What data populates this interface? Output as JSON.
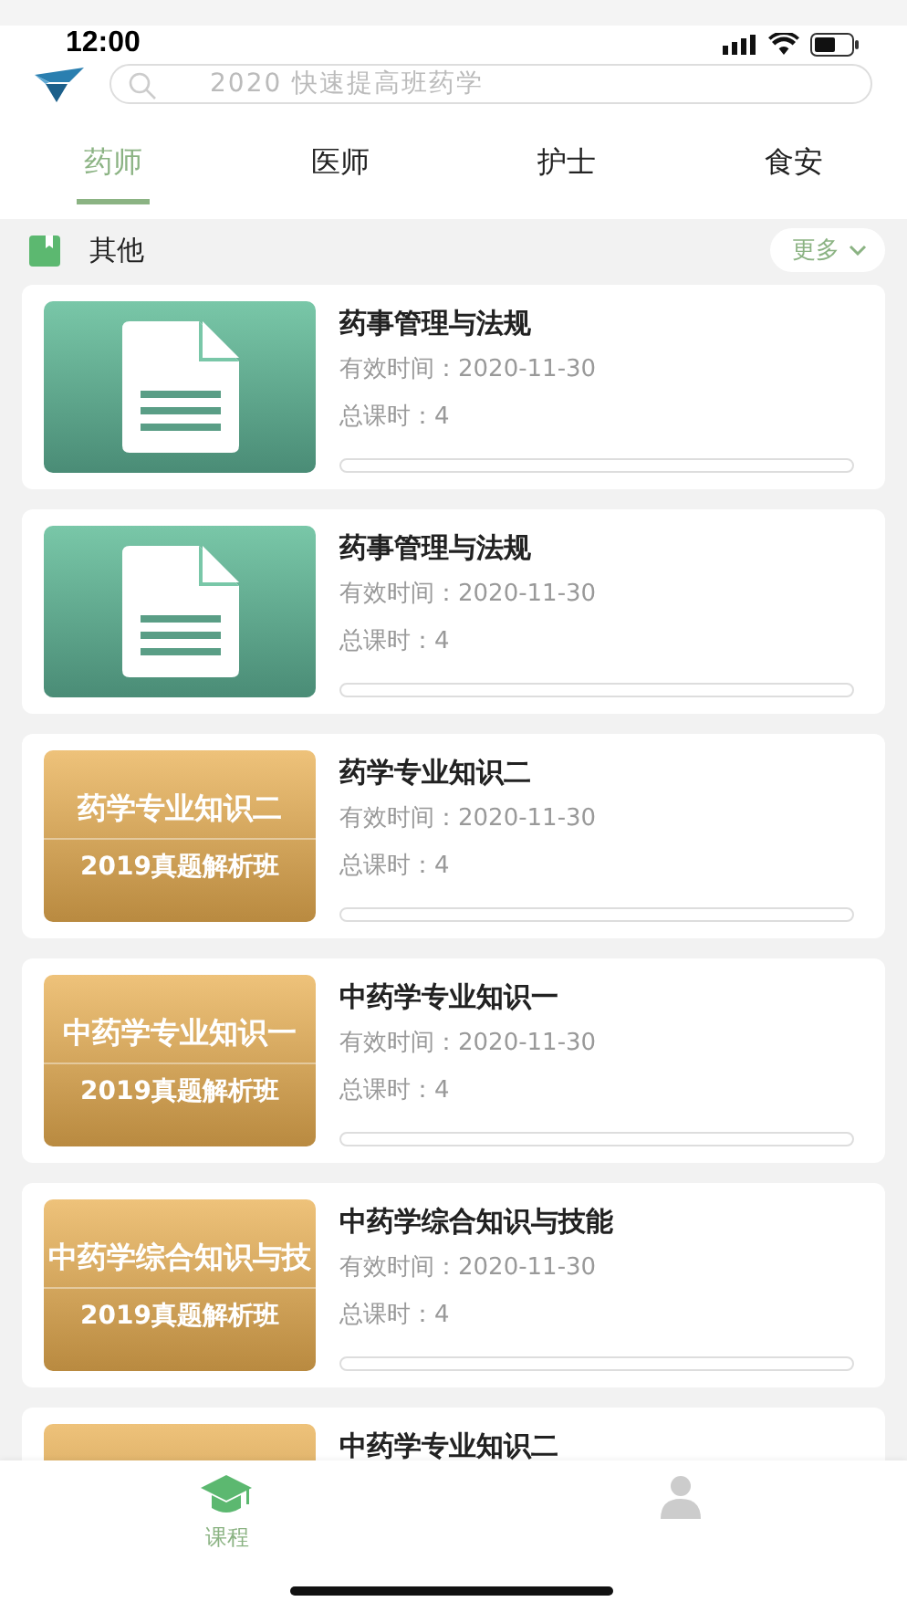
{
  "status_bar": {
    "time": "12:00"
  },
  "search": {
    "placeholder": "2020 快速提高班药学"
  },
  "tabs": [
    {
      "label": "药师",
      "selected": true
    },
    {
      "label": "医师",
      "selected": false
    },
    {
      "label": "护士",
      "selected": false
    },
    {
      "label": "食安",
      "selected": false
    }
  ],
  "section": {
    "title": "其他",
    "more": "更多"
  },
  "courses": [
    {
      "title": "药事管理与法规",
      "valid": "有效时间：2020-11-30",
      "hours": "总课时：4",
      "level": 0,
      "thumbnail": {
        "kind": "document"
      }
    },
    {
      "title": "药事管理与法规",
      "valid": "有效时间：2020-11-30",
      "hours": "总课时：4",
      "level": 0,
      "thumbnail": {
        "kind": "document"
      }
    },
    {
      "title": "药学专业知识二",
      "valid": "有效时间：2020-11-30",
      "hours": "总课时：4",
      "level": 0,
      "thumbnail": {
        "kind": "banner",
        "heading": "药学专业知识二",
        "subheading": "2019真题解析班"
      }
    },
    {
      "title": "中药学专业知识一",
      "valid": "有效时间：2020-11-30",
      "hours": "总课时：4",
      "level": 0,
      "thumbnail": {
        "kind": "banner",
        "heading": "中药学专业知识一",
        "subheading": "2019真题解析班"
      }
    },
    {
      "title": "中药学综合知识与技能",
      "valid": "有效时间：2020-11-30",
      "hours": "总课时：4",
      "level": 0,
      "thumbnail": {
        "kind": "banner",
        "heading": "中药学综合知识与技",
        "subheading": "2019真题解析班"
      }
    },
    {
      "title": "中药学专业知识二",
      "thumbnail": {
        "kind": "banner"
      }
    }
  ],
  "bottom_nav": [
    {
      "kind": "courses",
      "label": "课程",
      "selected": true
    },
    {
      "kind": "profile",
      "selected": false
    }
  ]
}
